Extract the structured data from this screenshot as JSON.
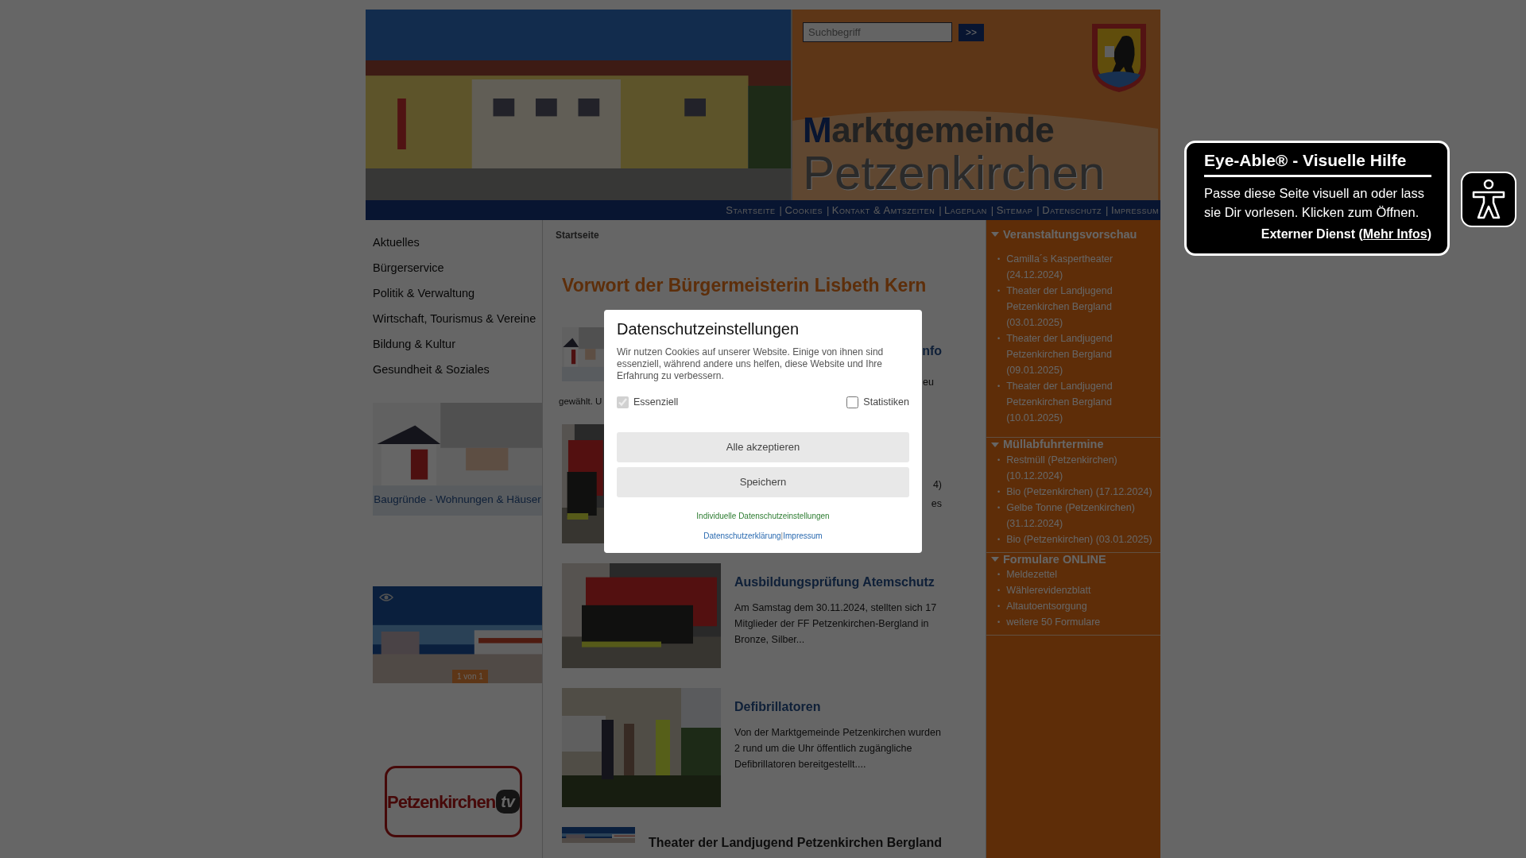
{
  "header": {
    "search": {
      "placeholder": "Suchbegriff"
    },
    "search_button": ">>",
    "title_line1": "Marktgemeinde",
    "title_line2": "Petzenkirchen"
  },
  "top_nav": [
    {
      "kind": "link",
      "text": "Startseite"
    },
    {
      "kind": "sep",
      "text": "|"
    },
    {
      "kind": "link",
      "text": "Cookies"
    },
    {
      "kind": "sep",
      "text": "|"
    },
    {
      "kind": "link",
      "text": "Kontakt & Amtszeiten"
    },
    {
      "kind": "sep",
      "text": "|"
    },
    {
      "kind": "link",
      "text": "Lageplan"
    },
    {
      "kind": "sep",
      "text": "|"
    },
    {
      "kind": "link",
      "text": "Sitemap"
    },
    {
      "kind": "sep",
      "text": "|"
    },
    {
      "kind": "link",
      "text": "Datenschutz"
    },
    {
      "kind": "sep",
      "text": "|"
    },
    {
      "kind": "link",
      "text": "Impressum"
    }
  ],
  "sidebar": {
    "items": [
      "Aktuelles",
      "Bürgerservice",
      "Politik & Verwaltung",
      "Wirtschaft, Tourismus & Vereine",
      "Bildung & Kultur",
      "Gesundheit & Soziales"
    ],
    "banner_caption": "Baugründe - Wohnungen & Häuser",
    "panorama_counter": "1 von 1",
    "tv_logo": {
      "name": "Petzenkirchen",
      "suffix": "tv"
    }
  },
  "content": {
    "breadcrumb": "Startseite",
    "heading": "Vorwort der Bürgermeisterin Lisbeth Kern",
    "hidden_article": {
      "title_fragment": "nfo",
      "text_fragments": [
        "eu",
        "gewählt. U"
      ]
    },
    "hidden_article_2": {
      "text_fragments": [
        "4)",
        "es"
      ]
    },
    "articles": [
      {
        "title": "Ausbildungsprüfung Atemschutz",
        "text": "Am Samstag dem 30.11.2024, stellten sich 17 Mitglieder der FF Petzenkirchen-Bergland in Bronze, Silber...",
        "kind": "picture"
      },
      {
        "title": "Defibrillatoren",
        "text": "Von der Marktgemeinde Petzenkirchen wurden 2 rund um die Uhr öffentlich zugängliche Defibrillatoren bereitgestellt....",
        "kind": "picture"
      }
    ],
    "last_article_title": "Theater der Landjugend Petzenkirchen Bergland"
  },
  "right_sidebar": [
    {
      "title": "Veranstaltungsvorschau",
      "expanded": true,
      "bullet": "•",
      "items": [
        "Camilla´s Kaspertheater (24.12.2024)",
        "Theater der Landjugend Petzenkirchen Bergland (03.01.2025)",
        "Theater der Landjugend Petzenkirchen Bergland (09.01.2025)",
        "Theater der Landjugend Petzenkirchen Bergland (10.01.2025)"
      ]
    },
    {
      "title": "Müllabfuhrtermine",
      "expanded": true,
      "bullet": "•",
      "items": [
        "Restmüll (Petzenkirchen) (10.12.2024)",
        "Bio (Petzenkirchen) (17.12.2024)",
        "Gelbe Tonne (Petzenkirchen) (31.12.2024)",
        "Bio (Petzenkirchen) (03.01.2025)"
      ]
    },
    {
      "title": "Formulare ONLINE",
      "expanded": true,
      "bullet": "•",
      "items": [
        "Meldezettel",
        "Wählerevidenzblatt",
        "Altautoentsorgung",
        "weitere 50 Formulare"
      ]
    }
  ],
  "cookie_dialog": {
    "title": "Datenschutzeinstellungen",
    "text": "Wir nutzen Cookies auf unserer Website. Einige von ihnen sind essenziell, während andere uns helfen, diese Website und Ihre Erfahrung zu verbessern.",
    "options": [
      {
        "label": "Essenziell",
        "checked": true,
        "disabled": true
      },
      {
        "label": "Statistiken",
        "checked": false,
        "disabled": false
      }
    ],
    "buttons": [
      "Alle akzeptieren",
      "Speichern"
    ],
    "settings_link": "Individuelle Datenschutzeinstellungen",
    "links": [
      "Datenschutzerklärung",
      "Impressum"
    ],
    "link_separator": "|"
  },
  "eye_able": {
    "title": "Eye-Able® - Visuelle Hilfe",
    "text": "Passe diese Seite visuell an oder lass sie Dir vorlesen. Klicken zum Öffnen.",
    "note": "Externer Dienst (",
    "link": "Mehr Infos",
    "note_end": ")"
  }
}
